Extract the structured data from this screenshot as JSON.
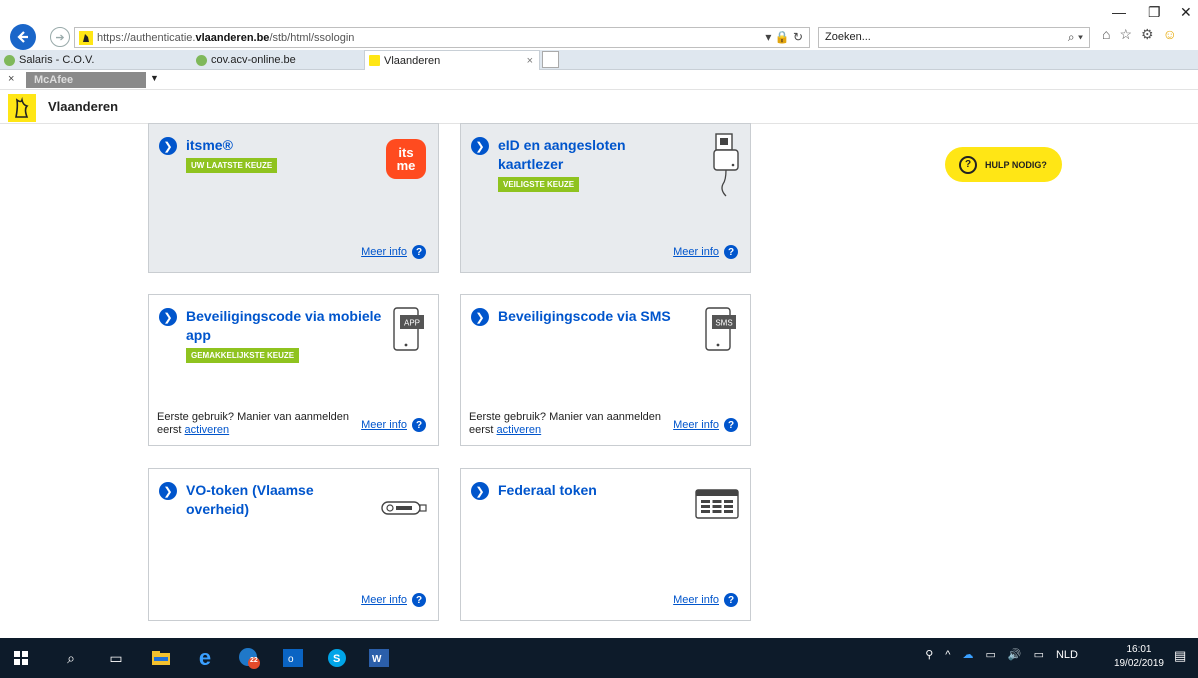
{
  "browser": {
    "url_prefix": "https://authenticatie.",
    "url_domain": "vlaanderen.be",
    "url_path": "/stb/html/ssologin",
    "addr_tools": "▾ 🔒 ↻",
    "search_placeholder": "Zoeken...",
    "tabs": [
      {
        "label": "Salaris - C.O.V."
      },
      {
        "label": "cov.acv-online.be"
      },
      {
        "label": "Vlaanderen",
        "close": "×"
      }
    ],
    "toolbar_close": "×",
    "toolbar_brand": "McAfee",
    "toolbar_dropdown": "▼"
  },
  "site": {
    "name": "Vlaanderen"
  },
  "help_button": {
    "label": "HULP NODIG?"
  },
  "cards": [
    {
      "title": "itsme®",
      "badge": "UW LAATSTE KEUZE",
      "meer": "Meer info",
      "icon": "itsme-logo",
      "logo_line1": "its",
      "logo_line2": "me"
    },
    {
      "title_line1": "eID en aangesloten",
      "title_line2": "kaartlezer",
      "badge": "VEILIGSTE KEUZE",
      "meer": "Meer info",
      "icon": "card-reader-icon"
    },
    {
      "title_line1": "Beveiligingscode via mobiele",
      "title_line2": "app",
      "badge": "GEMAKKELIJKSTE KEUZE",
      "first_use": "Eerste gebruik? Manier van aanmelden eerst",
      "activate": "activeren",
      "meer": "Meer info",
      "icon": "phone-app-icon",
      "icon_label": "APP"
    },
    {
      "title": "Beveiligingscode via SMS",
      "first_use": "Eerste gebruik? Manier van aanmelden eerst",
      "activate": "activeren",
      "meer": "Meer info",
      "icon": "phone-sms-icon",
      "icon_label": "SMS"
    },
    {
      "title_line1": "VO-token (Vlaamse",
      "title_line2": "overheid)",
      "meer": "Meer info",
      "icon": "usb-token-icon"
    },
    {
      "title": "Federaal token",
      "meer": "Meer info",
      "icon": "token-card-icon"
    }
  ],
  "taskbar": {
    "language": "NLD",
    "time": "16:01",
    "date": "19/02/2019",
    "badge_count": "22"
  },
  "colors": {
    "brand_blue": "#0055cc",
    "badge_green": "#8fc31f",
    "help_yellow": "#ffe615",
    "itsme_orange": "#ff4b1f"
  }
}
